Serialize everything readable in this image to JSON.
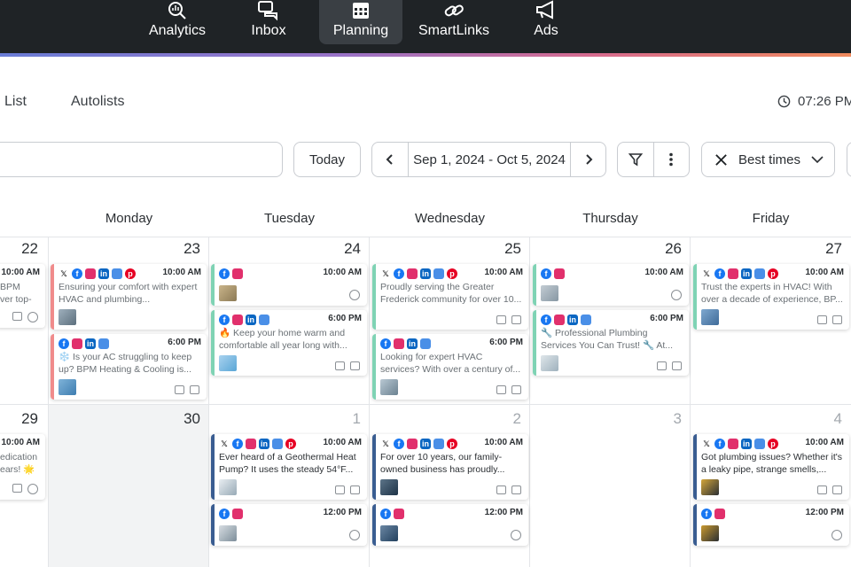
{
  "nav": {
    "items": [
      {
        "label": "Analytics",
        "icon": "analytics-icon"
      },
      {
        "label": "Inbox",
        "icon": "inbox-icon"
      },
      {
        "label": "Planning",
        "icon": "calendar-icon",
        "active": true
      },
      {
        "label": "SmartLinks",
        "icon": "link-icon"
      },
      {
        "label": "Ads",
        "icon": "megaphone-icon"
      }
    ]
  },
  "subtabs": {
    "list": "List",
    "autolists": "Autolists",
    "time": "07:26 PM"
  },
  "toolbar": {
    "today": "Today",
    "date_range": "Sep 1, 2024 - Oct 5, 2024",
    "best_times": "Best times"
  },
  "calendar": {
    "days": [
      "Monday",
      "Tuesday",
      "Wednesday",
      "Thursday",
      "Friday"
    ],
    "week1": [
      "22",
      "23",
      "24",
      "25",
      "26",
      "27"
    ],
    "week2": [
      "29",
      "30",
      "1",
      "2",
      "3",
      "4"
    ],
    "posts": {
      "sun1_a_time": "10:00 AM",
      "sun1_a_text": "BPM\nver top-",
      "mon1_a_time": "10:00 AM",
      "mon1_a_text": "Ensuring your comfort with expert HVAC and plumbing...",
      "mon1_b_time": "6:00 PM",
      "mon1_b_text": "❄️ Is your AC struggling to keep up? BPM Heating & Cooling is...",
      "tue1_a_time": "10:00 AM",
      "tue1_a_text": "",
      "tue1_b_time": "6:00 PM",
      "tue1_b_text": "🔥 Keep your home warm and comfortable all year long with...",
      "wed1_a_time": "10:00 AM",
      "wed1_a_text": "Proudly serving the Greater Frederick community for over 10...",
      "wed1_b_time": "6:00 PM",
      "wed1_b_text": "Looking for expert HVAC services? With over a century of...",
      "thu1_a_time": "10:00 AM",
      "thu1_a_text": "",
      "thu1_b_time": "6:00 PM",
      "thu1_b_text": "🔧 Professional Plumbing Services You Can Trust! 🔧 At...",
      "fri1_a_time": "10:00 AM",
      "fri1_a_text": "Trust the experts in HVAC! With over a decade of experience, BP...",
      "sun2_a_time": "10:00 AM",
      "sun2_a_text": "edication\nears! 🌟",
      "tue2_a_time": "10:00 AM",
      "tue2_a_text": "Ever heard of a Geothermal Heat Pump? It uses the steady 54°F...",
      "tue2_b_time": "12:00 PM",
      "wed2_a_time": "10:00 AM",
      "wed2_a_text": "For over 10 years, our family-owned business has proudly...",
      "wed2_b_time": "12:00 PM",
      "fri2_a_time": "10:00 AM",
      "fri2_a_text": "Got plumbing issues? Whether it's a leaky pipe, strange smells,...",
      "fri2_b_time": "12:00 PM"
    }
  },
  "colors": {
    "pink_bar": "#f08b8b",
    "green_bar": "#7fd3b4",
    "blue_bar": "#3a5d91",
    "nav_bg": "#1f2326"
  }
}
